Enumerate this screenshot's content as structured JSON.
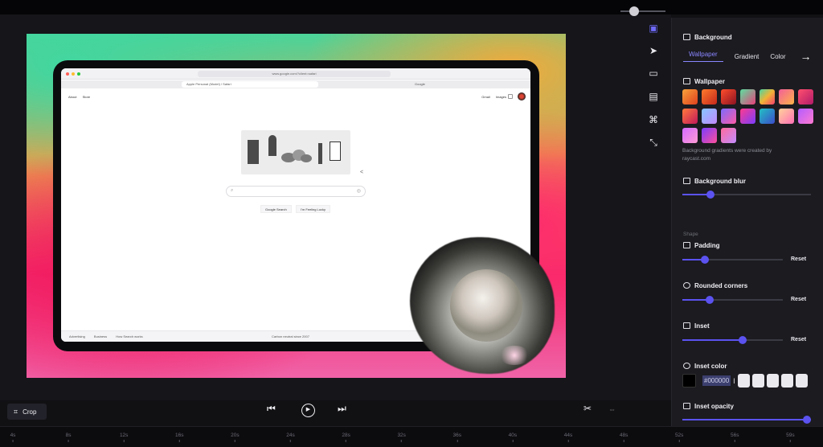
{
  "browser": {
    "url": "www.google.com/?client=safari",
    "tab_active": "Apple Personal (Model) / Safari",
    "tab_other": "Google"
  },
  "google": {
    "link_about": "About",
    "link_store": "Store",
    "link_gmail": "Gmail",
    "link_images": "Images",
    "btn_search": "Google Search",
    "btn_lucky": "I'm Feeling Lucky",
    "footer_advertising": "Advertising",
    "footer_business": "Business",
    "footer_how": "How Search works",
    "footer_carbon": "Carbon neutral since 2007"
  },
  "toolstrip": {
    "icons": [
      "layout-icon",
      "cursor-icon",
      "camera-icon",
      "caption-icon",
      "command-icon",
      "transform-icon"
    ],
    "accent": "#6f6af8"
  },
  "panel": {
    "background_title": "Background",
    "tabs": [
      "Wallpaper",
      "Gradient",
      "Color"
    ],
    "active_tab": "Wallpaper",
    "wallpaper_title": "Wallpaper",
    "wallpaper_note_line1": "Background gradients were created by",
    "wallpaper_note_line2": "raycast.com",
    "blur_title": "Background blur",
    "blur_value": 0.22,
    "shape_label": "Shape",
    "padding_title": "Padding",
    "padding_value": 0.22,
    "rounded_title": "Rounded corners",
    "rounded_value": 0.27,
    "inset_title": "Inset",
    "inset_value": 0.6,
    "reset_label": "Reset",
    "inset_color_title": "Inset color",
    "inset_color_value": "#000000",
    "inset_opacity_title": "Inset opacity",
    "inset_opacity_value": 1.0,
    "accent": "#5b52f0"
  },
  "controls": {
    "crop_label": "Crop",
    "zoom_value": 0.2
  },
  "ruler": {
    "ticks": [
      "4s",
      "8s",
      "12s",
      "16s",
      "20s",
      "24s",
      "28s",
      "32s",
      "36s",
      "40s",
      "44s",
      "48s",
      "52s",
      "56s",
      "59s"
    ]
  }
}
